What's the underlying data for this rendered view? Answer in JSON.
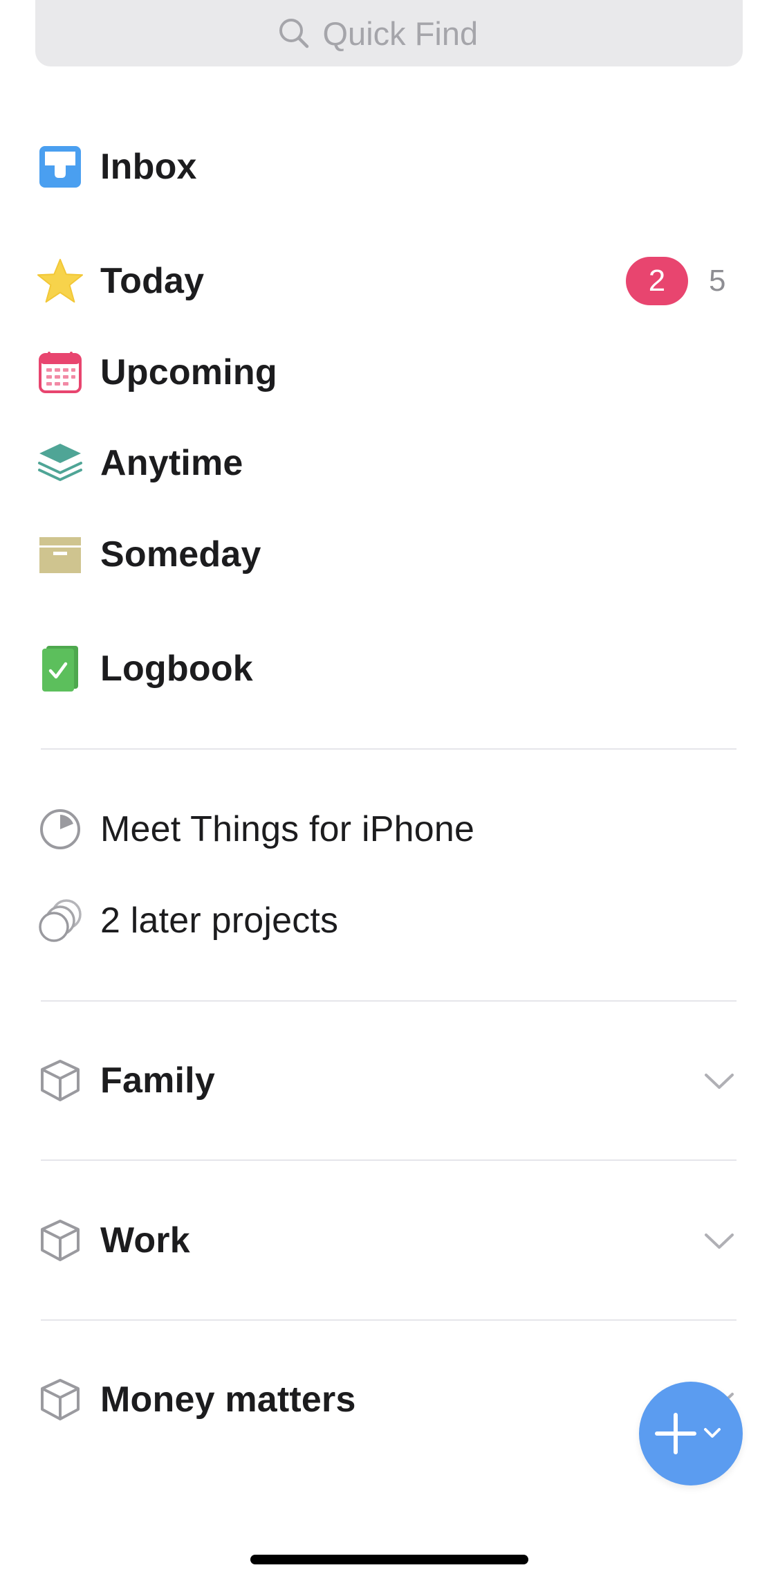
{
  "search": {
    "placeholder": "Quick Find",
    "icon": "search-icon"
  },
  "nav": {
    "inbox": {
      "label": "Inbox",
      "icon": "inbox-tray-icon",
      "color": "#4a9ff0"
    },
    "today": {
      "label": "Today",
      "icon": "star-icon",
      "color": "#f7d34b",
      "badge": "2",
      "count": "5",
      "badge_color": "#e8456f"
    },
    "upcoming": {
      "label": "Upcoming",
      "icon": "calendar-icon",
      "color": "#e8456f"
    },
    "anytime": {
      "label": "Anytime",
      "icon": "layers-icon",
      "color": "#4fa596"
    },
    "someday": {
      "label": "Someday",
      "icon": "archive-box-icon",
      "color": "#cfc48f"
    },
    "logbook": {
      "label": "Logbook",
      "icon": "logbook-check-icon",
      "color": "#5cbf5c"
    }
  },
  "projects": {
    "meet_things": {
      "label": "Meet Things for iPhone",
      "icon": "progress-pie-icon"
    },
    "later": {
      "label": "2 later projects",
      "icon": "stacked-circles-icon"
    }
  },
  "areas": [
    {
      "label": "Family",
      "icon": "cube-icon",
      "chevron": "chevron-down-icon"
    },
    {
      "label": "Work",
      "icon": "cube-icon",
      "chevron": "chevron-down-icon"
    },
    {
      "label": "Money matters",
      "icon": "cube-icon",
      "chevron": "chevron-down-icon"
    }
  ],
  "fab": {
    "icon": "plus-icon",
    "secondary_icon": "chevron-down-icon",
    "color": "#5b9cf0"
  }
}
